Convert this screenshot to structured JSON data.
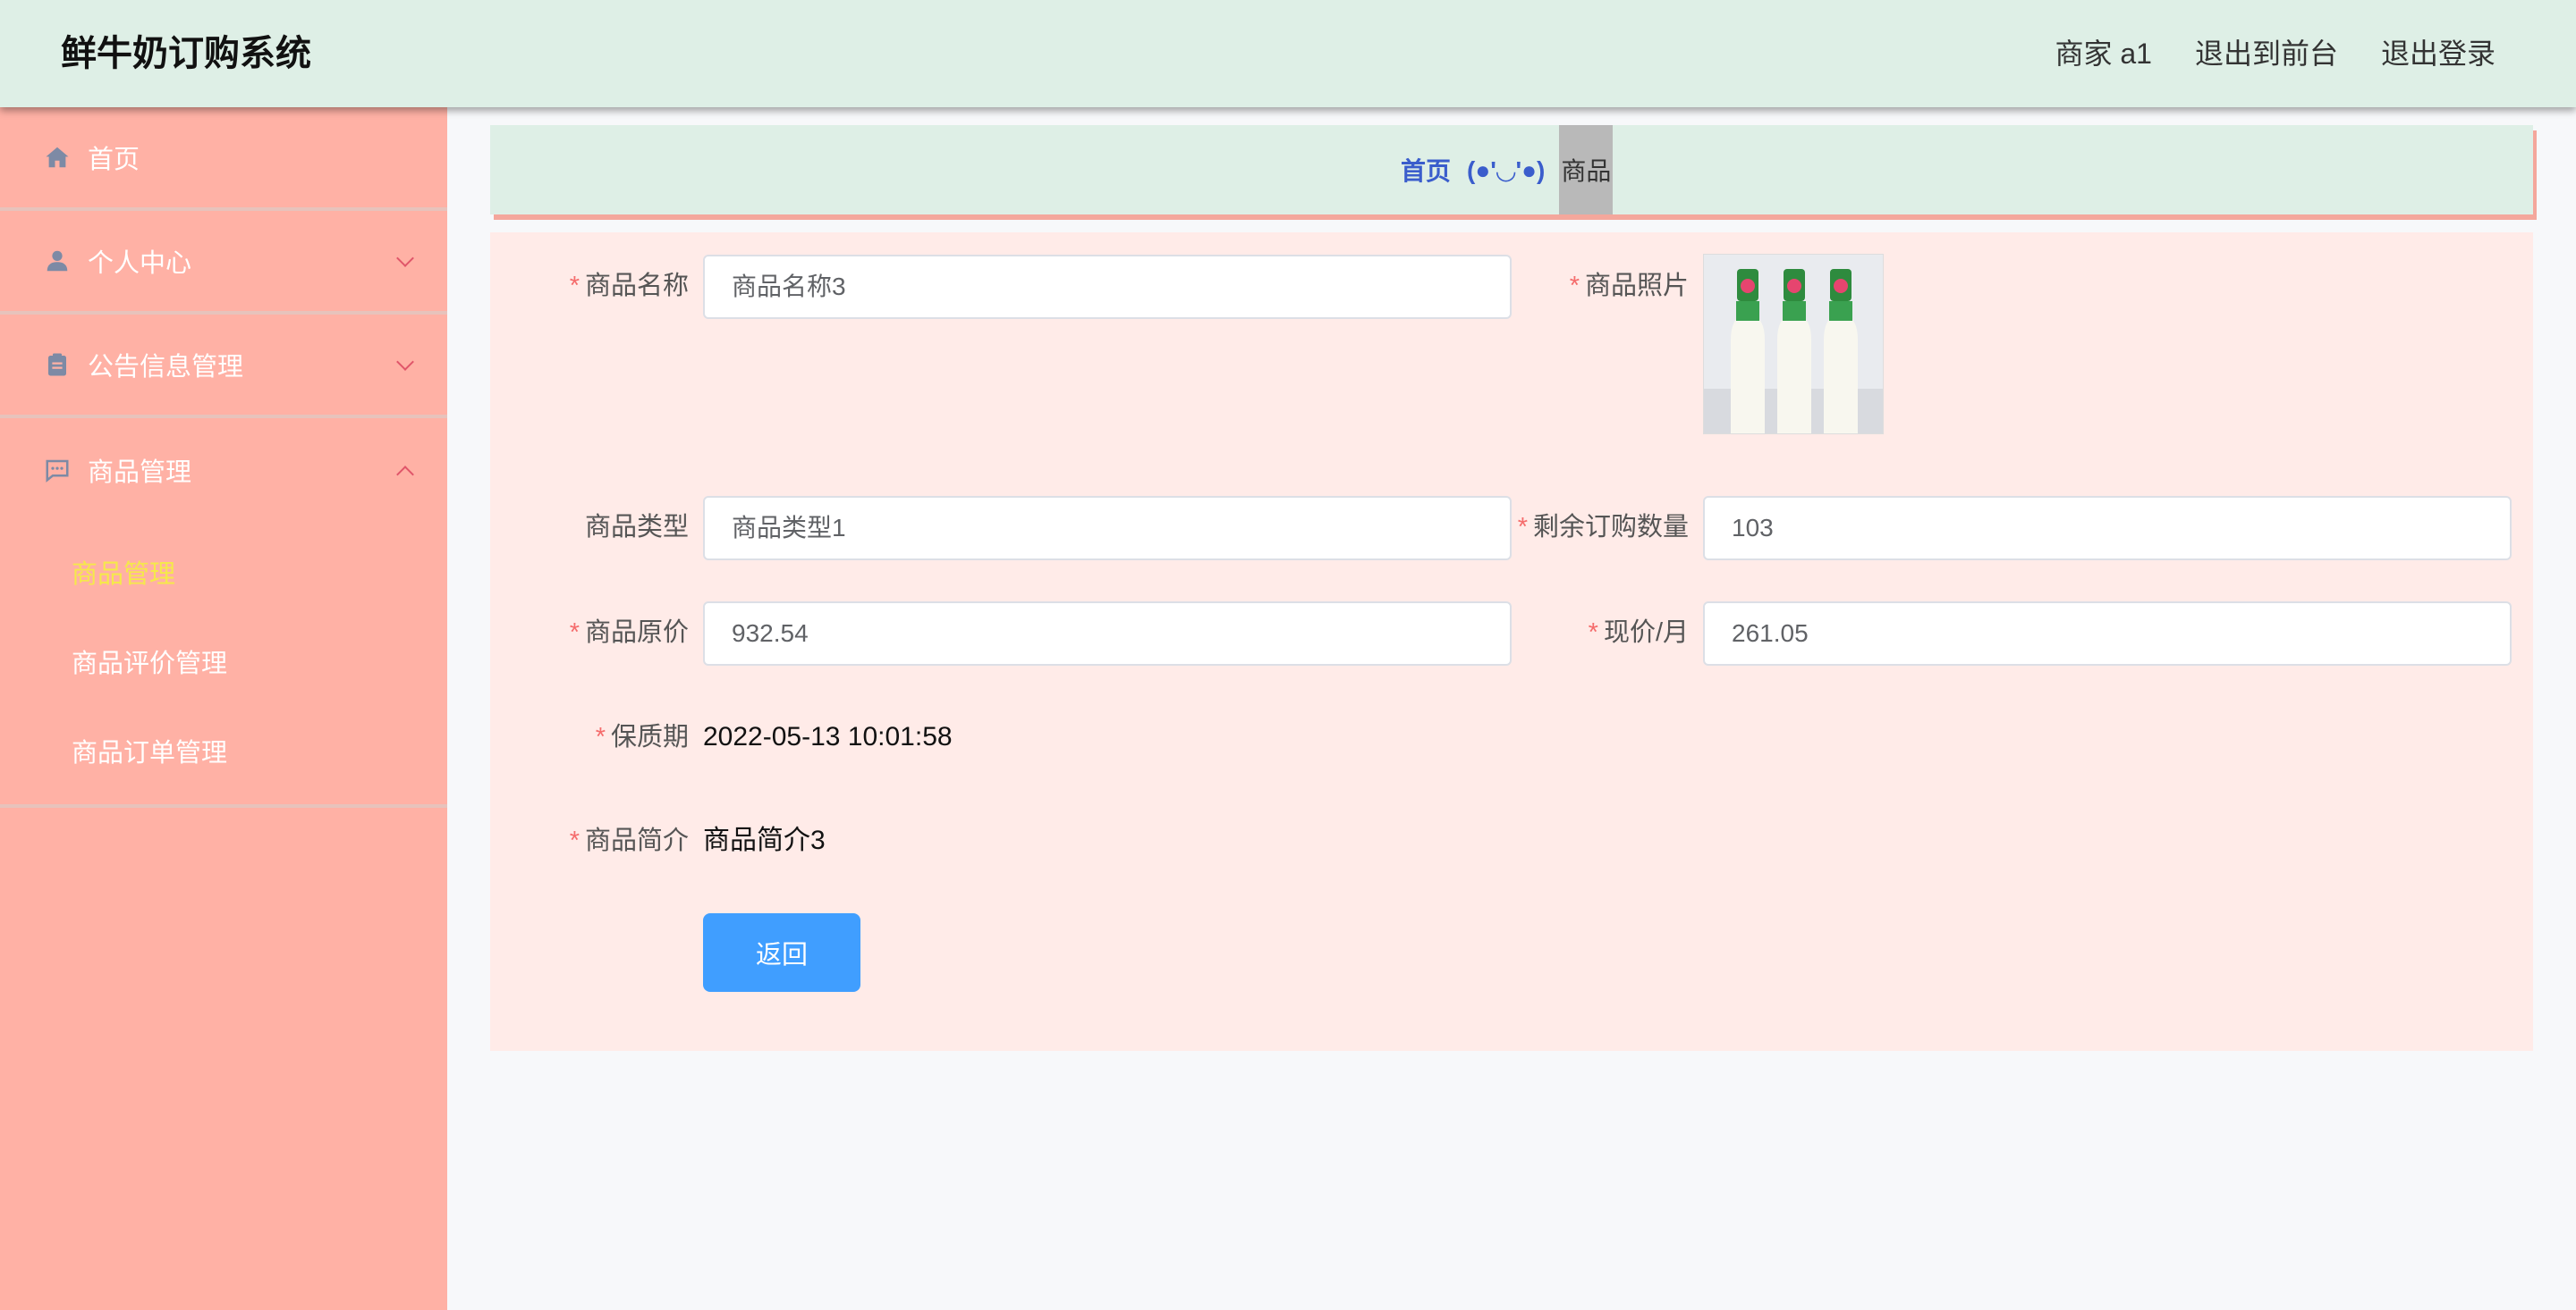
{
  "header": {
    "title": "鲜牛奶订购系统",
    "user_label": "商家 a1",
    "to_front_label": "退出到前台",
    "logout_label": "退出登录"
  },
  "sidebar": {
    "items": [
      {
        "label": "首页",
        "icon": "home-icon"
      },
      {
        "label": "个人中心",
        "icon": "user-icon",
        "expanded": false
      },
      {
        "label": "公告信息管理",
        "icon": "clipboard-icon",
        "expanded": false
      },
      {
        "label": "商品管理",
        "icon": "message-icon",
        "expanded": true
      }
    ],
    "submenu": [
      {
        "label": "商品管理",
        "active": true
      },
      {
        "label": "商品评价管理",
        "active": false
      },
      {
        "label": "商品订单管理",
        "active": false
      }
    ]
  },
  "breadcrumb": {
    "home": "首页",
    "separator": "(●'◡'●)",
    "current": "商品"
  },
  "form": {
    "name_label": "商品名称",
    "name_value": "商品名称3",
    "photo_label": "商品照片",
    "type_label": "商品类型",
    "type_value": "商品类型1",
    "stock_label": "剩余订购数量",
    "stock_value": "103",
    "orig_price_label": "商品原价",
    "orig_price_value": "932.54",
    "cur_price_label": "现价/月",
    "cur_price_value": "261.05",
    "shelf_label": "保质期",
    "shelf_value": "2022-05-13 10:01:58",
    "intro_label": "商品简介",
    "intro_value": "商品简介3",
    "back_label": "返回",
    "required_mark": "*"
  },
  "colors": {
    "header_bg": "#deefe6",
    "sidebar_bg": "#ffb1a5",
    "panel_bg": "#ffebe8",
    "active_sub": "#f5e94a",
    "primary": "#409eff",
    "required": "#f56c6c"
  }
}
